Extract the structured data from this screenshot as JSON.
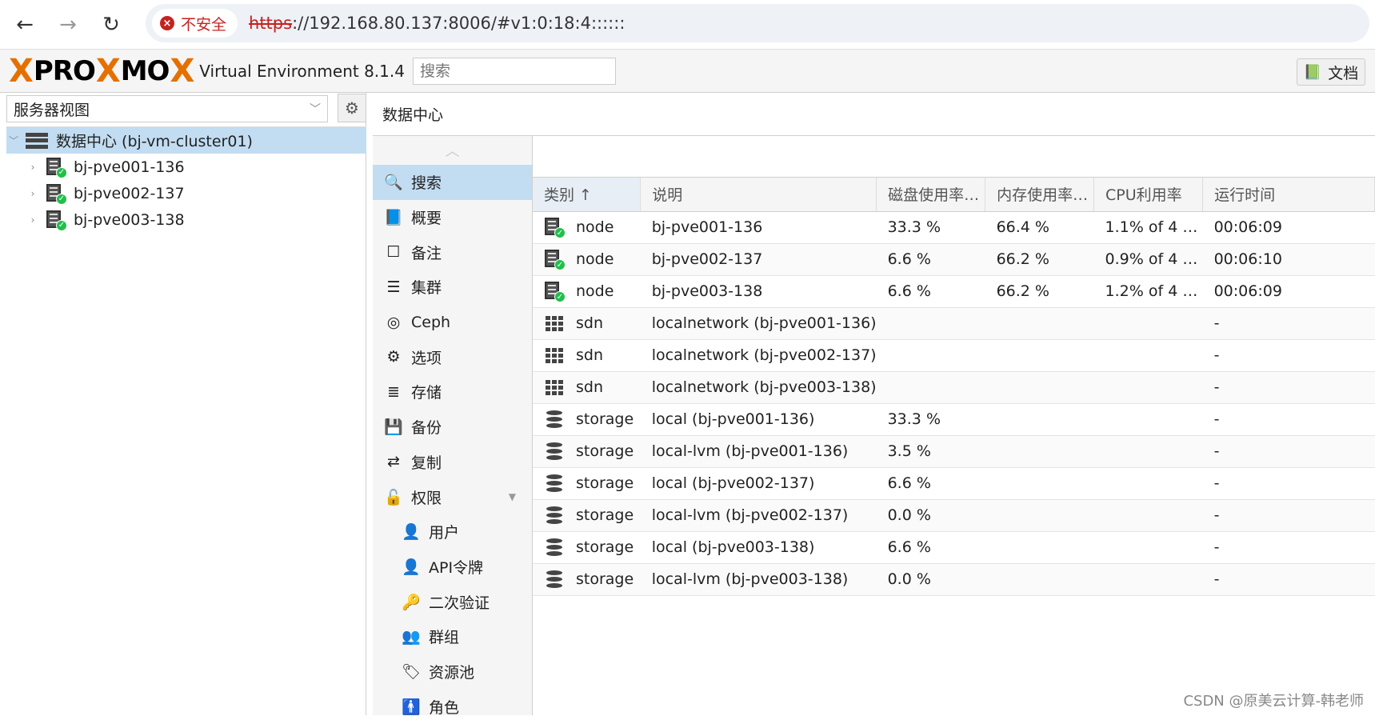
{
  "browser": {
    "insecure_label": "不安全",
    "url_scheme": "https",
    "url_rest": "://192.168.80.137:8006/#v1:0:18:4::::::"
  },
  "header": {
    "logo_left": "PRO",
    "logo_x1": "X",
    "logo_mid": "MO",
    "logo_x2": "X",
    "version": "Virtual Environment 8.1.4",
    "search_placeholder": "搜索",
    "doc_label": "文档",
    "accent": "#e57000"
  },
  "left": {
    "view_selector": "服务器视图",
    "tree": {
      "datacenter": "数据中心 (bj-vm-cluster01)",
      "nodes": [
        "bj-pve001-136",
        "bj-pve002-137",
        "bj-pve003-138"
      ]
    }
  },
  "breadcrumb": "数据中心",
  "menu": {
    "items": [
      {
        "label": "搜索",
        "icon": "search-icon",
        "glyph": "🔍"
      },
      {
        "label": "概要",
        "icon": "book-icon",
        "glyph": "📘"
      },
      {
        "label": "备注",
        "icon": "note-icon",
        "glyph": "☐"
      },
      {
        "label": "集群",
        "icon": "cluster-icon",
        "glyph": "☰"
      },
      {
        "label": "Ceph",
        "icon": "ceph-icon",
        "glyph": "◎"
      },
      {
        "label": "选项",
        "icon": "gear-icon",
        "glyph": "⚙"
      },
      {
        "label": "存储",
        "icon": "database-icon",
        "glyph": "≣"
      },
      {
        "label": "备份",
        "icon": "floppy-icon",
        "glyph": "💾"
      },
      {
        "label": "复制",
        "icon": "retweet-icon",
        "glyph": "⇄"
      },
      {
        "label": "权限",
        "icon": "unlock-icon",
        "glyph": "🔓"
      }
    ],
    "subitems": [
      {
        "label": "用户",
        "icon": "user-icon",
        "glyph": "👤"
      },
      {
        "label": "API令牌",
        "icon": "user-outline-icon",
        "glyph": "👤"
      },
      {
        "label": "二次验证",
        "icon": "key-icon",
        "glyph": "🔑"
      },
      {
        "label": "群组",
        "icon": "users-icon",
        "glyph": "👥"
      },
      {
        "label": "资源池",
        "icon": "tags-icon",
        "glyph": "🏷"
      },
      {
        "label": "角色",
        "icon": "male-icon",
        "glyph": "🚹"
      }
    ]
  },
  "table": {
    "headers": [
      "类别 ↑",
      "说明",
      "磁盘使用率…",
      "内存使用率…",
      "CPU利用率",
      "运行时间"
    ],
    "rows": [
      {
        "type": "node",
        "desc": "bj-pve001-136",
        "disk": "33.3 %",
        "mem": "66.4 %",
        "cpu": "1.1% of 4 …",
        "uptime": "00:06:09"
      },
      {
        "type": "node",
        "desc": "bj-pve002-137",
        "disk": "6.6 %",
        "mem": "66.2 %",
        "cpu": "0.9% of 4 …",
        "uptime": "00:06:10"
      },
      {
        "type": "node",
        "desc": "bj-pve003-138",
        "disk": "6.6 %",
        "mem": "66.2 %",
        "cpu": "1.2% of 4 …",
        "uptime": "00:06:09"
      },
      {
        "type": "sdn",
        "desc": "localnetwork (bj-pve001-136)",
        "disk": "",
        "mem": "",
        "cpu": "",
        "uptime": "-"
      },
      {
        "type": "sdn",
        "desc": "localnetwork (bj-pve002-137)",
        "disk": "",
        "mem": "",
        "cpu": "",
        "uptime": "-"
      },
      {
        "type": "sdn",
        "desc": "localnetwork (bj-pve003-138)",
        "disk": "",
        "mem": "",
        "cpu": "",
        "uptime": "-"
      },
      {
        "type": "storage",
        "desc": "local (bj-pve001-136)",
        "disk": "33.3 %",
        "mem": "",
        "cpu": "",
        "uptime": "-"
      },
      {
        "type": "storage",
        "desc": "local-lvm (bj-pve001-136)",
        "disk": "3.5 %",
        "mem": "",
        "cpu": "",
        "uptime": "-"
      },
      {
        "type": "storage",
        "desc": "local (bj-pve002-137)",
        "disk": "6.6 %",
        "mem": "",
        "cpu": "",
        "uptime": "-"
      },
      {
        "type": "storage",
        "desc": "local-lvm (bj-pve002-137)",
        "disk": "0.0 %",
        "mem": "",
        "cpu": "",
        "uptime": "-"
      },
      {
        "type": "storage",
        "desc": "local (bj-pve003-138)",
        "disk": "6.6 %",
        "mem": "",
        "cpu": "",
        "uptime": "-"
      },
      {
        "type": "storage",
        "desc": "local-lvm (bj-pve003-138)",
        "disk": "0.0 %",
        "mem": "",
        "cpu": "",
        "uptime": "-"
      }
    ]
  },
  "watermark": "CSDN @原美云计算-韩老师"
}
